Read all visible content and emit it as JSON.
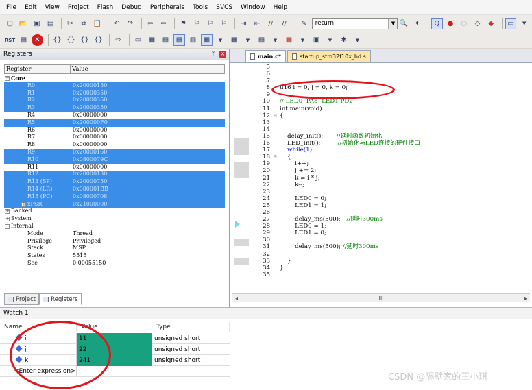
{
  "menubar": [
    "File",
    "Edit",
    "View",
    "Project",
    "Flash",
    "Debug",
    "Peripherals",
    "Tools",
    "SVCS",
    "Window",
    "Help"
  ],
  "toolbar1": {
    "search_value": "return"
  },
  "toolbar2": {
    "reset_label": "RST"
  },
  "registers_panel": {
    "title": "Registers",
    "col_register": "Register",
    "col_value": "Value",
    "groups": [
      {
        "label": "Core",
        "kind": "group-open"
      },
      {
        "label": "R0",
        "value": "0x20000150",
        "sel": true
      },
      {
        "label": "R1",
        "value": "0x20000350",
        "sel": true
      },
      {
        "label": "R2",
        "value": "0x20000350",
        "sel": true
      },
      {
        "label": "R3",
        "value": "0x20000350",
        "sel": true
      },
      {
        "label": "R4",
        "value": "0x00000000",
        "sel": false
      },
      {
        "label": "R5",
        "value": "0x200000F0",
        "sel": true
      },
      {
        "label": "R6",
        "value": "0x00000000",
        "sel": false
      },
      {
        "label": "R7",
        "value": "0x00000000",
        "sel": false
      },
      {
        "label": "R8",
        "value": "0x00000000",
        "sel": false
      },
      {
        "label": "R9",
        "value": "0x20000160",
        "sel": true
      },
      {
        "label": "R10",
        "value": "0x0800079C",
        "sel": true
      },
      {
        "label": "R11",
        "value": "0x00000000",
        "sel": false
      },
      {
        "label": "R12",
        "value": "0x20000130",
        "sel": true
      },
      {
        "label": "R13 (SP)",
        "value": "0x20000750",
        "sel": true
      },
      {
        "label": "R14 (LR)",
        "value": "0x080001BB",
        "sel": true
      },
      {
        "label": "R15 (PC)",
        "value": "0x08000708",
        "sel": true
      },
      {
        "label": "xPSR",
        "value": "0x21000000",
        "sel": true,
        "expandable": true
      },
      {
        "label": "Banked",
        "kind": "group-closed"
      },
      {
        "label": "System",
        "kind": "group-closed"
      },
      {
        "label": "Internal",
        "kind": "group-open"
      },
      {
        "label": "Mode",
        "value": "Thread",
        "sel": false
      },
      {
        "label": "Privilege",
        "value": "Privileged",
        "sel": false
      },
      {
        "label": "Stack",
        "value": "MSP",
        "sel": false
      },
      {
        "label": "States",
        "value": "5515",
        "sel": false
      },
      {
        "label": "Sec",
        "value": "0.00055150",
        "sel": false
      }
    ],
    "tab_project": "Project",
    "tab_registers": "Registers"
  },
  "editor": {
    "tab_active": "main.c*",
    "tab_inactive": "startup_stm32f10x_hd.s",
    "scroll_center": "III",
    "lines": [
      {
        "n": "5",
        "fold": "",
        "code": ""
      },
      {
        "n": "6",
        "fold": "",
        "code": ""
      },
      {
        "n": "7",
        "fold": "",
        "code": ""
      },
      {
        "n": "8",
        "fold": "",
        "code": "u16 i = 0, j = 0, k = 0;"
      },
      {
        "n": "9",
        "fold": "",
        "code": ""
      },
      {
        "n": "10",
        "fold": "",
        "code": "// LED0  PA8  LED1 PD2",
        "cls": "cm"
      },
      {
        "n": "11",
        "fold": "",
        "code": "int main(void)",
        "kwprefix": "int"
      },
      {
        "n": "12",
        "fold": "⊟",
        "code": "{"
      },
      {
        "n": "13",
        "fold": "",
        "code": ""
      },
      {
        "n": "14",
        "fold": "",
        "code": ""
      },
      {
        "n": "15",
        "fold": "",
        "code": "    delay_init();",
        "comment": "       //延时函数初始化"
      },
      {
        "n": "16",
        "fold": "",
        "code": "    LED_Init();",
        "comment": "         //初始化与LED连接的硬件接口"
      },
      {
        "n": "17",
        "fold": "",
        "code": "    while(1)",
        "kwline": true
      },
      {
        "n": "18",
        "fold": "⊟",
        "code": "    {"
      },
      {
        "n": "19",
        "fold": "",
        "code": "        i++;"
      },
      {
        "n": "20",
        "fold": "",
        "code": "        j += 2;"
      },
      {
        "n": "21",
        "fold": "",
        "code": "        k = i * j;"
      },
      {
        "n": "22",
        "fold": "",
        "code": "        k--;"
      },
      {
        "n": "23",
        "fold": "",
        "code": ""
      },
      {
        "n": "24",
        "fold": "",
        "code": "        LED0 = 0;"
      },
      {
        "n": "25",
        "fold": "",
        "code": "        LED1 = 1;"
      },
      {
        "n": "26",
        "fold": "",
        "code": ""
      },
      {
        "n": "27",
        "fold": "",
        "code": "        delay_ms(500);",
        "comment": "   //延时300ms"
      },
      {
        "n": "28",
        "fold": "",
        "code": "        LED0 = 1;"
      },
      {
        "n": "29",
        "fold": "",
        "code": "        LED1 = 0;"
      },
      {
        "n": "30",
        "fold": "",
        "code": ""
      },
      {
        "n": "31",
        "fold": "",
        "code": "        delay_ms(500);",
        "comment": " //延时300ms"
      },
      {
        "n": "32",
        "fold": "",
        "code": ""
      },
      {
        "n": "33",
        "fold": "",
        "code": "    }"
      },
      {
        "n": "34",
        "fold": "",
        "code": "}"
      },
      {
        "n": "35",
        "fold": "",
        "code": ""
      }
    ]
  },
  "watch": {
    "title": "Watch 1",
    "col_name": "Name",
    "col_value": "Value",
    "col_type": "Type",
    "rows": [
      {
        "name": "i",
        "value": "11",
        "type": "unsigned short"
      },
      {
        "name": "j",
        "value": "22",
        "type": "unsigned short"
      },
      {
        "name": "k",
        "value": "241",
        "type": "unsigned short"
      }
    ],
    "placeholder": "<Enter expression>"
  },
  "watermark": "CSDN @隔壁家的王小琪",
  "colors": {
    "selection": "#3a8ee8",
    "watch_highlight": "#18a17e",
    "annotation_red": "#e3141b",
    "keyword_blue": "#0000ff",
    "comment_green": "#008000"
  }
}
